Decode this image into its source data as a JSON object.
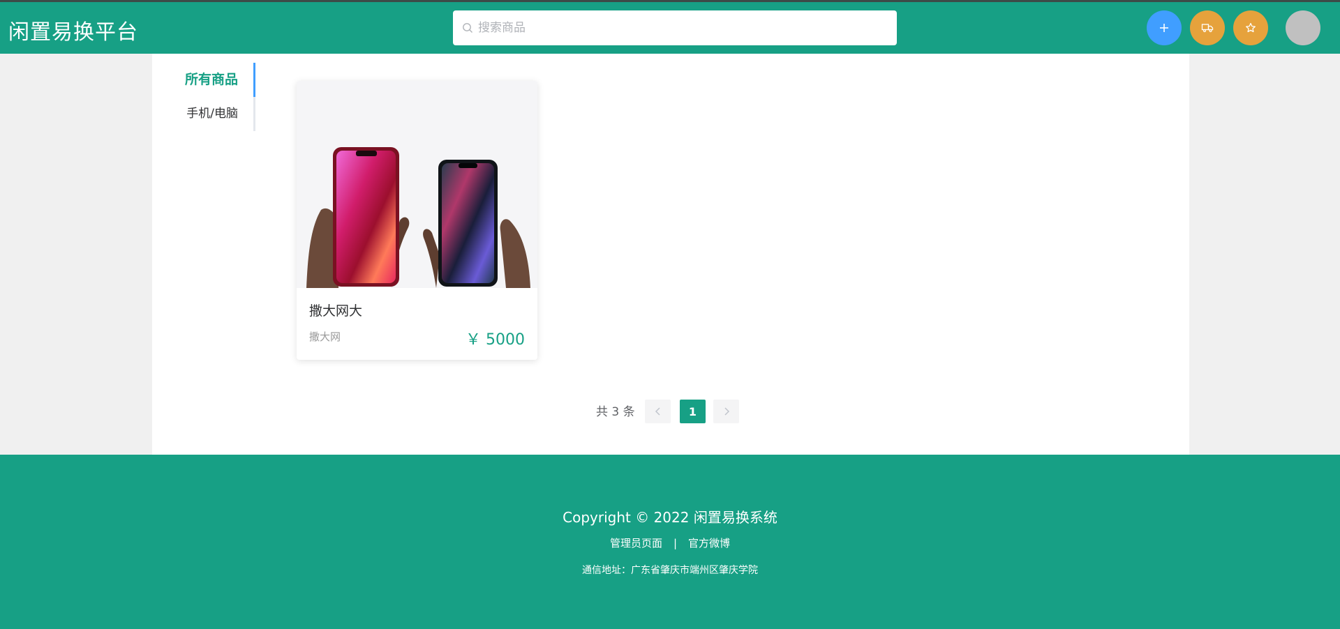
{
  "header": {
    "logo": "闲置易换平台",
    "search_placeholder": "搜索商品",
    "icons": {
      "add": "plus-icon",
      "truck": "truck-icon",
      "star": "star-icon"
    },
    "colors": {
      "brand": "#17a085",
      "add_button": "#409eff",
      "action_button": "#e6a23c"
    }
  },
  "sidebar": {
    "tabs": [
      {
        "label": "所有商品",
        "active": true
      },
      {
        "label": "手机/电脑",
        "active": false
      }
    ]
  },
  "products": [
    {
      "title": "撒大网大",
      "seller": "撒大网",
      "price": "￥ 5000",
      "image": "two-phones-in-hands"
    }
  ],
  "pagination": {
    "total": "共 3 条",
    "current": "1"
  },
  "footer": {
    "copyright": "Copyright © 2022 闲置易换系统",
    "links": [
      "管理员页面",
      "|",
      "官方微博"
    ],
    "address": "通信地址：广东省肇庆市端州区肇庆学院"
  }
}
